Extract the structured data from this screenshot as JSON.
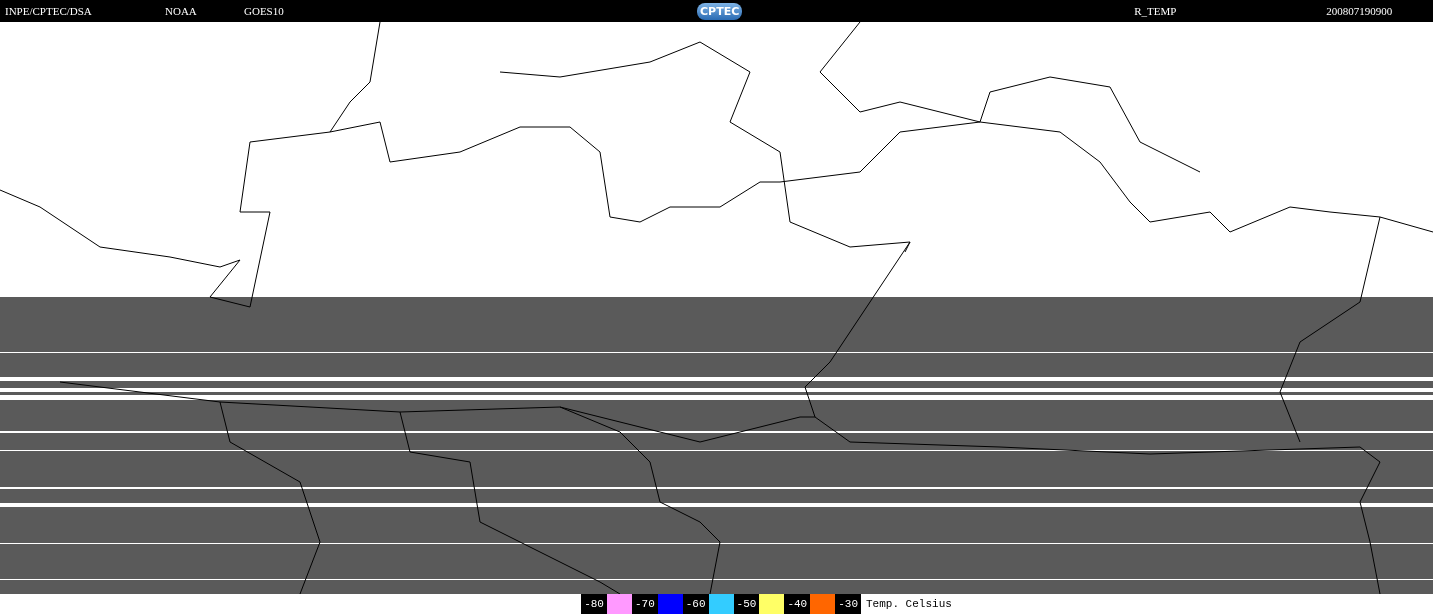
{
  "header": {
    "source": "INPE/CPTEC/DSA",
    "agency": "NOAA",
    "satellite": "GOES10",
    "logo": "CPTEC",
    "product": "R_TEMP",
    "timestamp": "200807190900"
  },
  "legend": {
    "entries": [
      {
        "value": "-80",
        "color": "#ff99ff"
      },
      {
        "value": "-70",
        "color": "#0000ff"
      },
      {
        "value": "-60",
        "color": "#33ccff"
      },
      {
        "value": "-50",
        "color": "#ffff66"
      },
      {
        "value": "-40",
        "color": "#ff6600"
      },
      {
        "value": "-30"
      }
    ],
    "caption": "Temp. Celsius"
  }
}
